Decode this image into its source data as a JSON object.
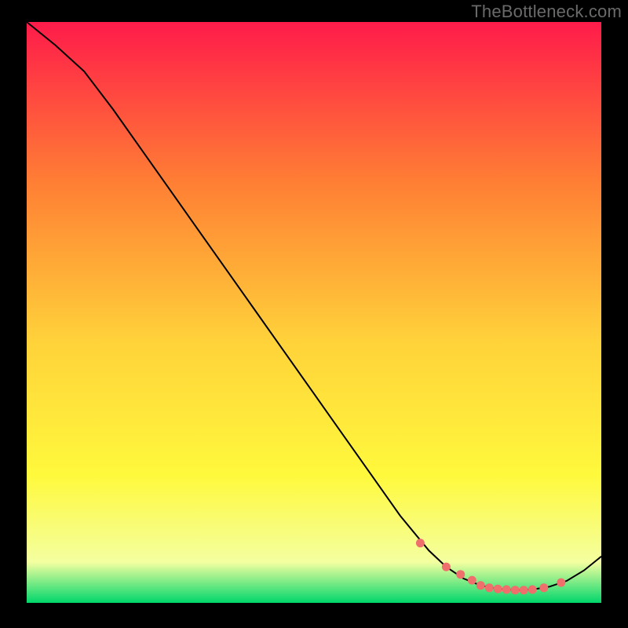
{
  "watermark": "TheBottleneck.com",
  "chart_data": {
    "type": "line",
    "title": "",
    "xlabel": "",
    "ylabel": "",
    "xlim": [
      0,
      100
    ],
    "ylim": [
      0,
      100
    ],
    "grid": false,
    "legend": false,
    "background_gradient": {
      "top_color": "#ff1b4a",
      "upper_mid_color": "#ff8034",
      "mid_color": "#ffd23a",
      "lower_mid_color": "#fff93c",
      "near_bottom_color": "#f4ffa0",
      "bottom_color": "#00d66b"
    },
    "series": [
      {
        "name": "curve",
        "color": "#000000",
        "x": [
          0,
          5,
          10,
          15,
          20,
          25,
          30,
          35,
          40,
          45,
          50,
          55,
          60,
          65,
          70,
          73,
          76,
          79,
          82,
          85,
          88,
          91,
          94,
          97,
          100
        ],
        "y": [
          100,
          96,
          91.5,
          85,
          78,
          71,
          64,
          57,
          50,
          43,
          36,
          29,
          22,
          15,
          9,
          6.2,
          4.2,
          3.0,
          2.4,
          2.2,
          2.3,
          2.8,
          3.8,
          5.6,
          8.0
        ]
      }
    ],
    "markers": {
      "name": "dots",
      "color": "#ef6f6d",
      "x": [
        68.5,
        73,
        75.5,
        77.5,
        79,
        80.5,
        82,
        83.5,
        85,
        86.5,
        88,
        90,
        93
      ],
      "y": [
        10.3,
        6.2,
        4.9,
        3.9,
        3.0,
        2.6,
        2.4,
        2.3,
        2.2,
        2.2,
        2.3,
        2.6,
        3.5
      ]
    }
  }
}
